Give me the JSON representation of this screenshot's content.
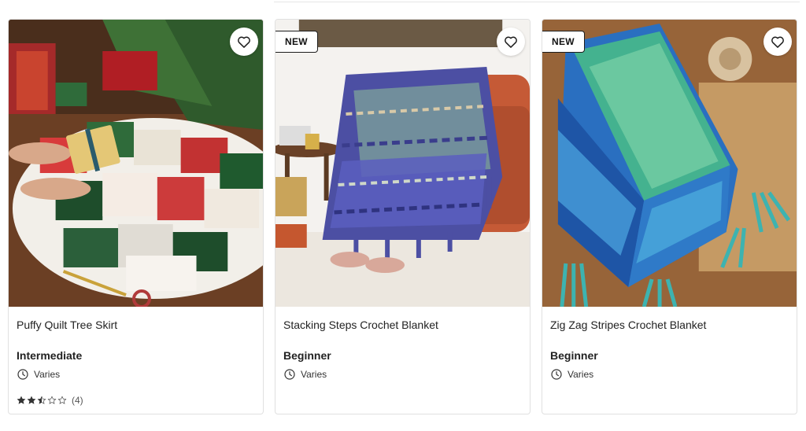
{
  "cards": [
    {
      "title": "Puffy Quilt Tree Skirt",
      "badge": "",
      "skill_level": "Intermediate",
      "time": "Varies",
      "rating": {
        "stars": 2.5,
        "count_label": "(4)"
      },
      "favorite_icon": "heart-outline-icon",
      "time_icon": "clock-icon"
    },
    {
      "title": "Stacking Steps Crochet Blanket",
      "badge": "NEW",
      "skill_level": "Beginner",
      "time": "Varies",
      "favorite_icon": "heart-outline-icon",
      "time_icon": "clock-icon"
    },
    {
      "title": "Zig Zag Stripes Crochet Blanket",
      "badge": "NEW",
      "skill_level": "Beginner",
      "time": "Varies",
      "favorite_icon": "heart-outline-icon",
      "time_icon": "clock-icon"
    }
  ],
  "colors": {
    "border": "#e0e0e0",
    "text": "#222222",
    "badge_border": "#1c1c1c"
  }
}
